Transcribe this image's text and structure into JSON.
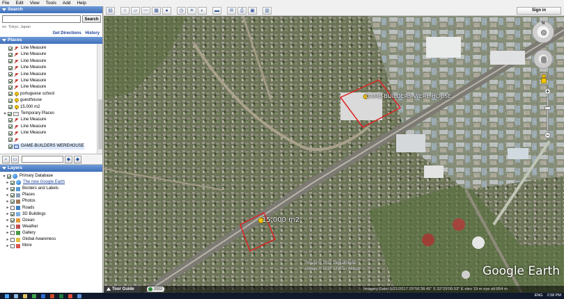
{
  "menu": [
    "File",
    "Edit",
    "View",
    "Tools",
    "Add",
    "Help"
  ],
  "search": {
    "header": "Search",
    "input_value": "",
    "button": "Search",
    "hint": "ex: Tokyo, Japan",
    "get_directions": "Get Directions",
    "history": "History"
  },
  "places": {
    "header": "Places",
    "items": [
      {
        "label": "Line Measure",
        "icon": "ruler-icon",
        "checked": true
      },
      {
        "label": "Line Measure",
        "icon": "ruler-icon",
        "checked": true
      },
      {
        "label": "Line Measure",
        "icon": "ruler-icon",
        "checked": true
      },
      {
        "label": "Line Measure",
        "icon": "ruler-icon",
        "checked": true
      },
      {
        "label": "Line Measure",
        "icon": "ruler-icon",
        "checked": true
      },
      {
        "label": "Line Measure",
        "icon": "ruler-icon",
        "checked": true
      },
      {
        "label": "Line Measure",
        "icon": "ruler-icon",
        "checked": true
      },
      {
        "label": "portuguese school",
        "icon": "pin-icon",
        "checked": true
      },
      {
        "label": "guesthouse",
        "icon": "pin-icon",
        "checked": true
      },
      {
        "label": "15,000 m2",
        "icon": "pin-icon",
        "checked": true
      },
      {
        "label": "Temporary Places",
        "icon": "folder-icon",
        "checked": true
      },
      {
        "label": "Line Measure",
        "icon": "ruler-icon",
        "checked": true
      },
      {
        "label": "Line Measure",
        "icon": "ruler-icon",
        "checked": true
      },
      {
        "label": "Line Measure",
        "icon": "ruler-icon",
        "checked": true
      },
      {
        "label": "",
        "icon": "ruler-icon",
        "checked": true
      },
      {
        "label": "GAME-BUILDERS WEREHOUSE",
        "icon": "polygon-icon",
        "checked": true
      }
    ]
  },
  "layers": {
    "header": "Layers",
    "items": [
      {
        "label": "Primary Database",
        "icon": "earth-icon",
        "checked": true
      },
      {
        "label": "The new Google Earth",
        "icon": "earth-icon",
        "checked": true,
        "link": true
      },
      {
        "label": "Borders and Labels",
        "icon": "layer-icon",
        "checked": true
      },
      {
        "label": "Places",
        "icon": "layer-icon",
        "checked": true
      },
      {
        "label": "Photos",
        "icon": "layer-icon",
        "checked": true
      },
      {
        "label": "Roads",
        "icon": "layer-icon",
        "checked": false
      },
      {
        "label": "3D Buildings",
        "icon": "layer-icon",
        "checked": true
      },
      {
        "label": "Ocean",
        "icon": "layer-icon",
        "checked": true
      },
      {
        "label": "Weather",
        "icon": "layer-icon",
        "checked": false
      },
      {
        "label": "Gallery",
        "icon": "layer-icon",
        "checked": false
      },
      {
        "label": "Global Awareness",
        "icon": "layer-icon",
        "checked": false
      },
      {
        "label": "More",
        "icon": "layer-icon",
        "checked": false
      }
    ]
  },
  "toolbar": {
    "sign_in": "Sign in"
  },
  "map": {
    "label_warehouse": "GAME-BUILDERS WERE HOUSE",
    "label_area": "15,000 m2",
    "image_credit_1": "Image © 2017 DigitalGlobe",
    "image_credit_2": "Image © 2017 CNES / Airbus",
    "brand": "Google Earth",
    "tour_guide": "Tour Guide",
    "year": "2002",
    "status": "Imagery Date: 5/21/2017    25°56'38.45\" S  32°29'09.53\" E  elev  19 m    eye alt  854 m",
    "highlight_color": "#e02020"
  },
  "taskbar": {
    "lang": "ENG",
    "time": "2:58 PM"
  }
}
